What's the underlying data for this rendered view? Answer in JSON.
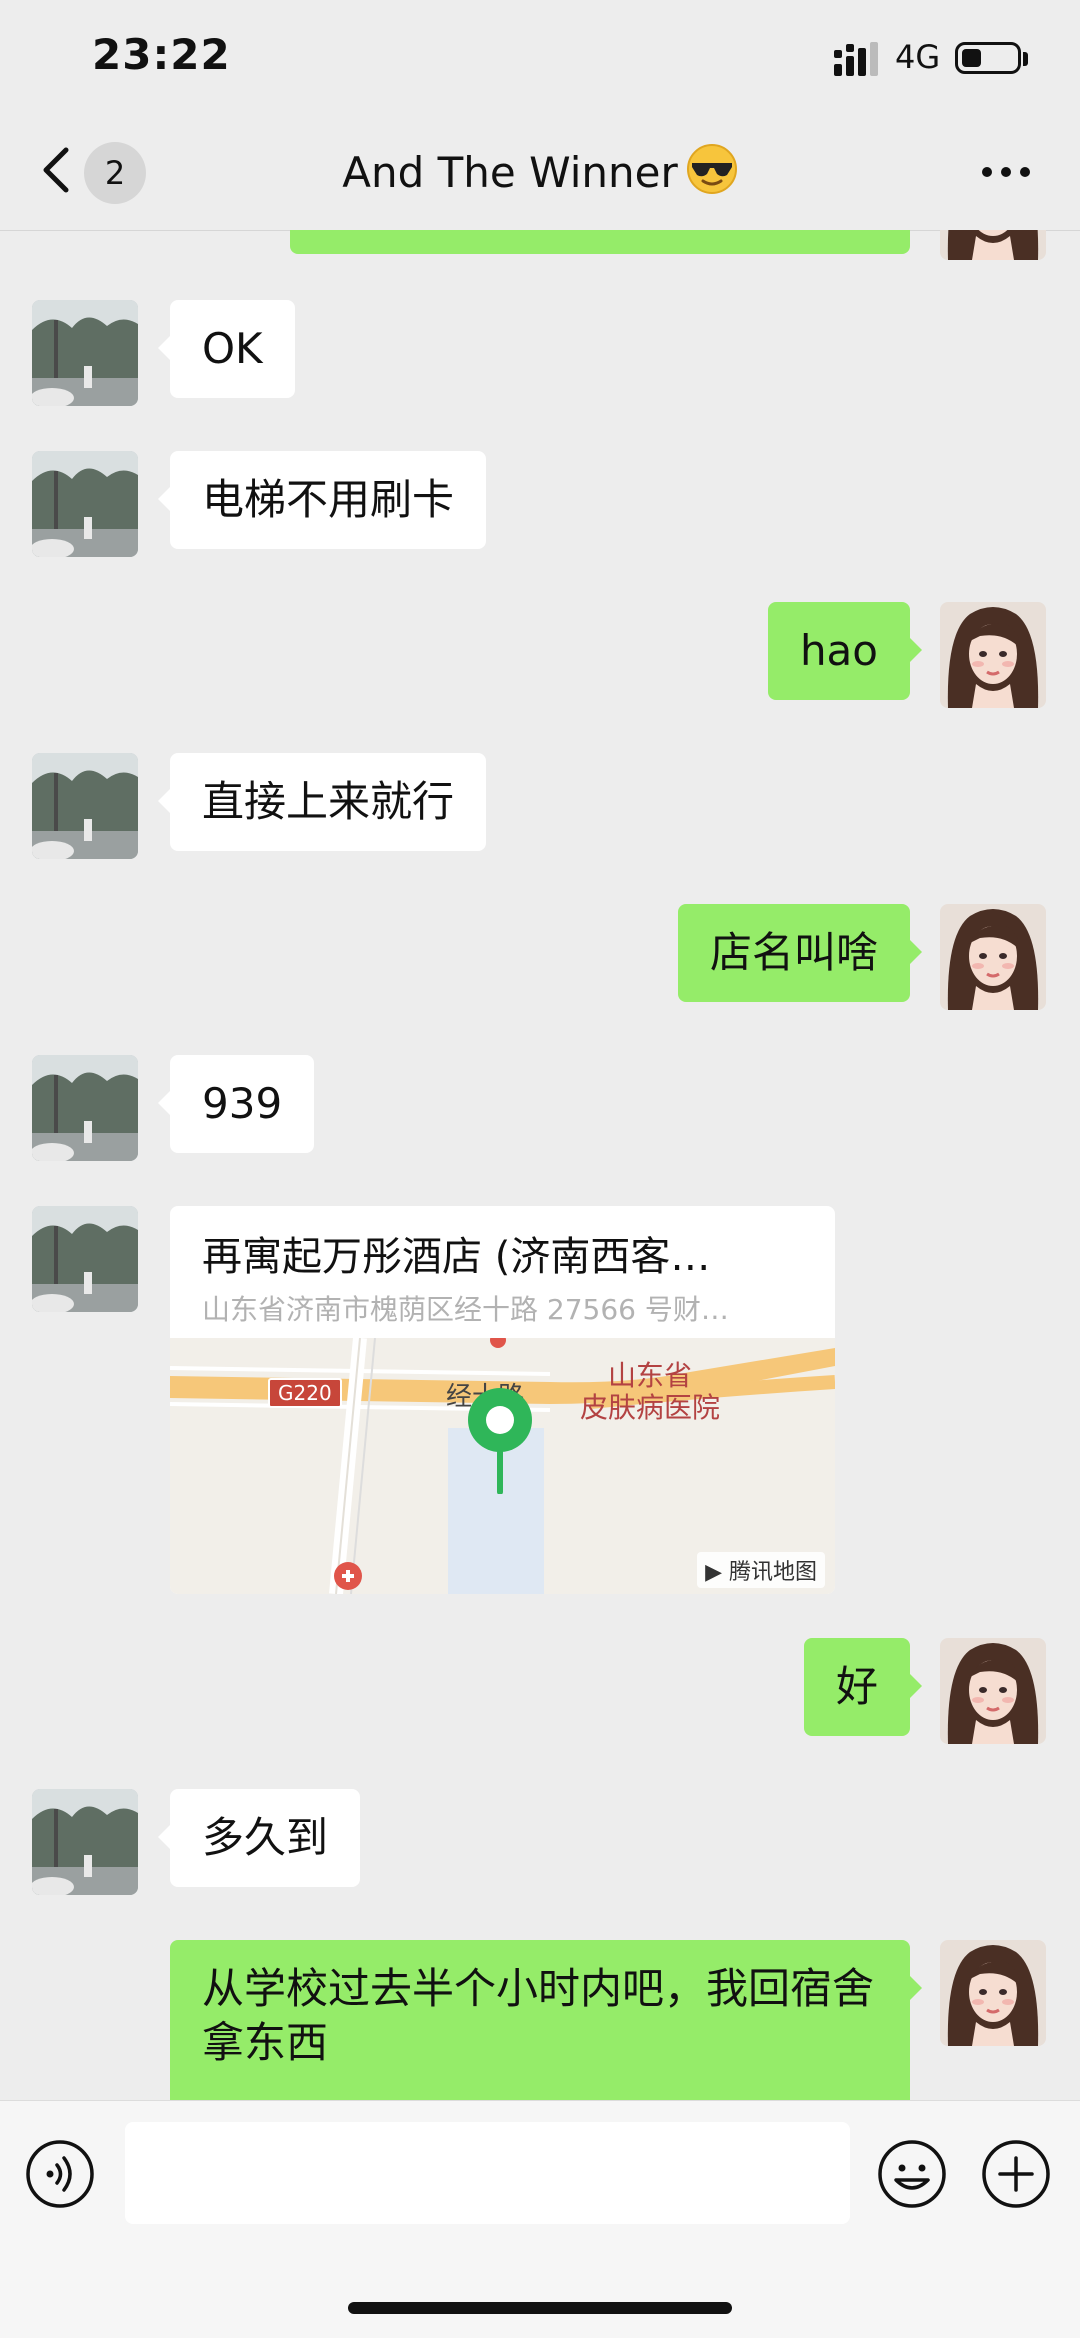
{
  "status_bar": {
    "time": "23:22",
    "network": "4G",
    "battery_level": 0.35
  },
  "nav": {
    "unread_count": "2",
    "title": "And The Winner"
  },
  "messages": [
    {
      "side": "in",
      "text": "OK"
    },
    {
      "side": "in",
      "text": "电梯不用刷卡"
    },
    {
      "side": "out",
      "text": "hao"
    },
    {
      "side": "in",
      "text": "直接上来就行"
    },
    {
      "side": "out",
      "text": "店名叫啥"
    },
    {
      "side": "in",
      "text": "939"
    },
    {
      "side": "in",
      "type": "location",
      "name": "再寓起万彤酒店 (济南西客…",
      "address": "山东省济南市槐荫区经十路 27566 号财…",
      "map": {
        "road_tag": "G220",
        "road_label": "经十路",
        "poi_label": "山东省\n皮肤病医院",
        "brand": "腾讯地图"
      }
    },
    {
      "side": "out",
      "text": "好"
    },
    {
      "side": "in",
      "text": "多久到"
    },
    {
      "side": "out",
      "text": "从学校过去半个小时内吧，我回宿舍拿东西"
    }
  ],
  "input": {
    "value": "",
    "placeholder": ""
  },
  "colors": {
    "outgoing_bubble": "#95ec69",
    "incoming_bubble": "#ffffff",
    "background": "#ededed",
    "pin": "#2fb659"
  }
}
